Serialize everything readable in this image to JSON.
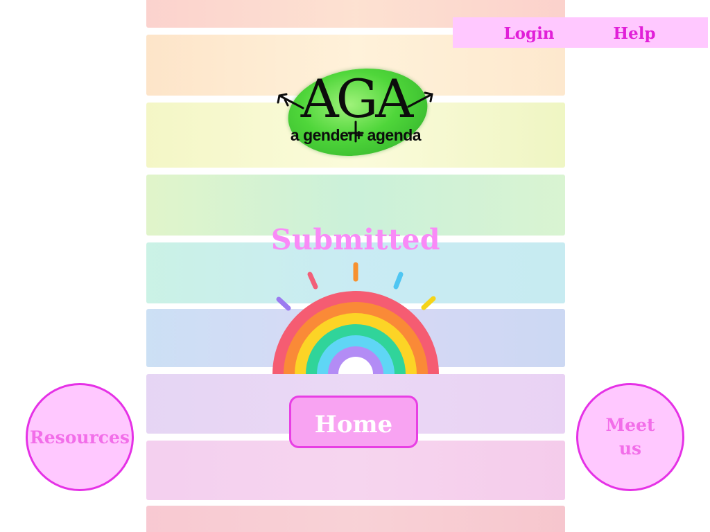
{
  "nav": {
    "login_label": "Login",
    "help_label": "Help"
  },
  "logo": {
    "mark": "AGA",
    "tagline": "a gender+ agenda"
  },
  "main": {
    "title": "Submitted",
    "home_label": "Home"
  },
  "side": {
    "resources_label": "Resources",
    "meet_label": "Meet us"
  },
  "colors": {
    "accent_pink": "#f98af7",
    "nav_bg": "#ffc8ff",
    "border_magenta": "#e531e6",
    "logo_green": "#4fd63a"
  }
}
